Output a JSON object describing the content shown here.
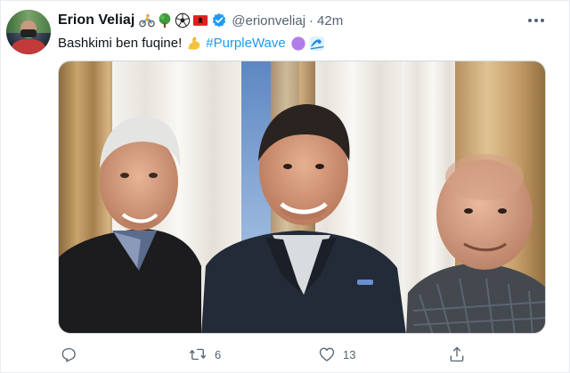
{
  "tweet": {
    "author": {
      "name": "Erion Veliaj",
      "handle": "@erionveliaj",
      "time": "42m",
      "separator": "·",
      "verified": true
    },
    "name_emojis": [
      "cyclist-icon",
      "tree-icon",
      "soccer-ball-icon",
      "albania-flag-icon"
    ],
    "text": {
      "plain": "Bashkimi ben fuqine!",
      "hashtag": "#PurpleWave",
      "emojis_inline": [
        "flexed-biceps-icon"
      ],
      "emojis_trailing": [
        "purple-circle-icon",
        "water-wave-icon"
      ]
    },
    "media": {
      "kind": "photo",
      "people_count": 3
    },
    "actions": {
      "reply_count": "",
      "retweet_count": "6",
      "like_count": "13"
    },
    "colors": {
      "accent": "#1d9bf0",
      "secondary_text": "#536471",
      "primary_text": "#0f1419"
    }
  }
}
